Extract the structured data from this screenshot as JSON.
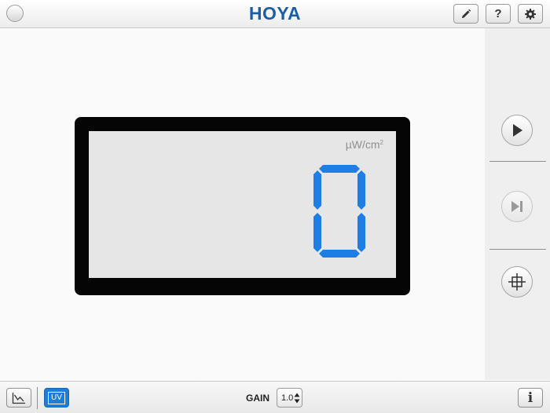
{
  "header": {
    "brand": "HOYA",
    "buttons": [
      {
        "name": "pencil",
        "icon": "pencil-icon"
      },
      {
        "name": "help",
        "label": "?"
      },
      {
        "name": "settings",
        "icon": "gear-icon"
      }
    ]
  },
  "display": {
    "unit": "µW/cm",
    "unit_superscript": "2",
    "value": "0",
    "digit_color": "#1e7ee6",
    "frame_color": "#050505",
    "screen_color": "#e6e6e6"
  },
  "sidebar": {
    "buttons": [
      {
        "name": "play",
        "icon": "play-icon",
        "enabled": true
      },
      {
        "name": "step-forward",
        "icon": "skip-next-icon",
        "enabled": false
      },
      {
        "name": "target",
        "icon": "crosshair-icon",
        "enabled": true
      }
    ]
  },
  "footer": {
    "chart_button": {
      "icon": "chart-icon"
    },
    "uv_button": {
      "label": "UV",
      "active": true
    },
    "gain": {
      "label": "GAIN",
      "value": "1.0"
    },
    "info_button": {
      "label": "i"
    }
  },
  "colors": {
    "brand": "#1a5fa6",
    "accent": "#1d7ed6"
  }
}
